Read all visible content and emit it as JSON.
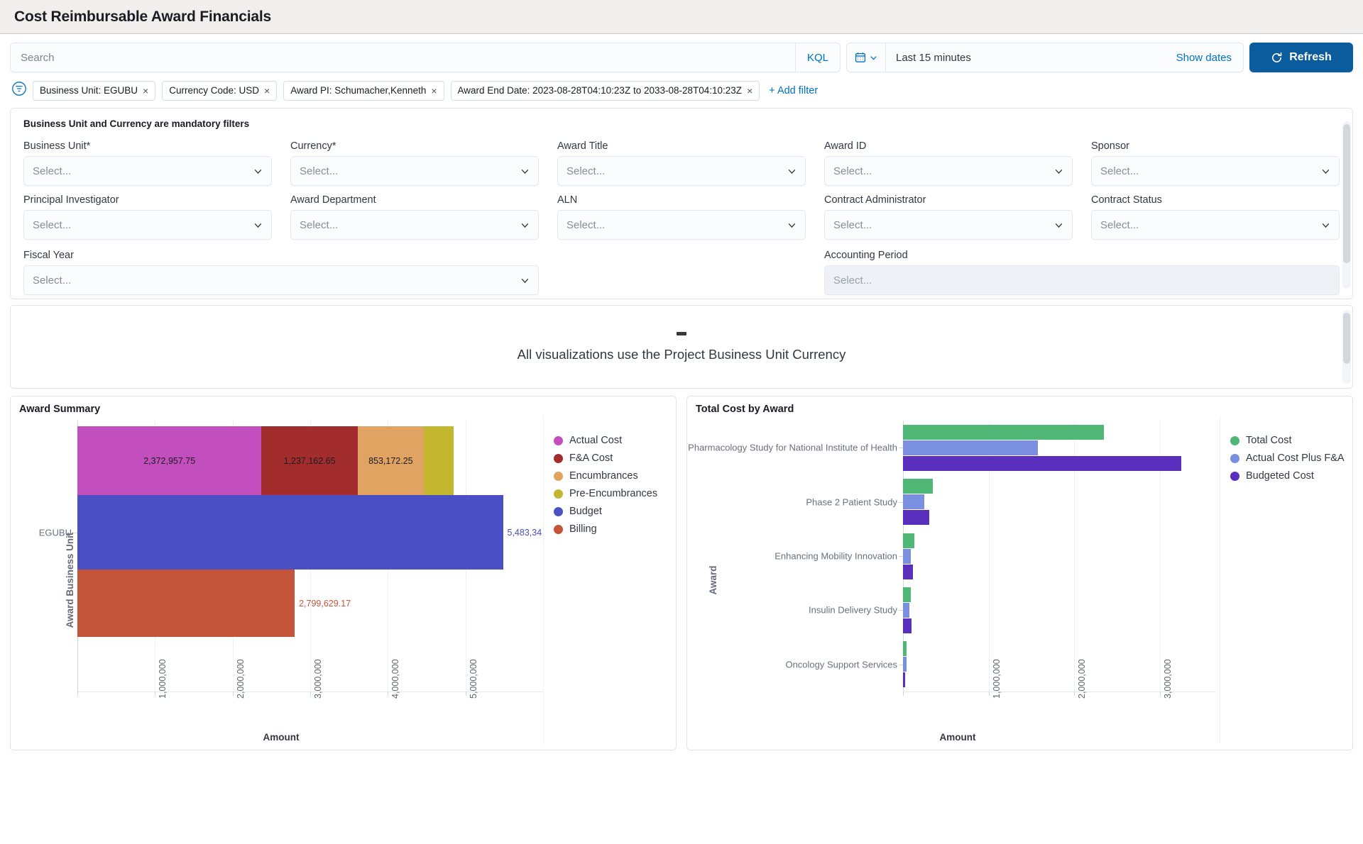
{
  "header": {
    "title": "Cost Reimbursable Award Financials"
  },
  "query": {
    "search_placeholder": "Search",
    "search_value": "",
    "kql_label": "KQL",
    "calendar_icon": "calendar-icon",
    "date_range": "Last 15 minutes",
    "show_dates_label": "Show dates",
    "refresh_label": "Refresh",
    "refresh_icon": "refresh-icon"
  },
  "filters": {
    "toggle_icon": "filter-toggle-icon",
    "pills": [
      {
        "label": "Business Unit: EGUBU"
      },
      {
        "label": "Currency Code: USD"
      },
      {
        "label": "Award PI: Schumacher,Kenneth"
      },
      {
        "label": "Award End Date: 2023-08-28T04:10:23Z to 2033-08-28T04:10:23Z"
      }
    ],
    "remove_glyph": "×",
    "add_filter_label": "+ Add filter"
  },
  "controls": {
    "note": "Business Unit and Currency are mandatory filters",
    "placeholder": "Select...",
    "fields": [
      {
        "label": "Business Unit*",
        "value": "Select...",
        "disabled": false
      },
      {
        "label": "Currency*",
        "value": "Select...",
        "disabled": false
      },
      {
        "label": "Award Title",
        "value": "Select...",
        "disabled": false
      },
      {
        "label": "Award ID",
        "value": "Select...",
        "disabled": false
      },
      {
        "label": "Sponsor",
        "value": "Select...",
        "disabled": false
      },
      {
        "label": "Principal Investigator",
        "value": "Select...",
        "disabled": false
      },
      {
        "label": "Award Department",
        "value": "Select...",
        "disabled": false
      },
      {
        "label": "ALN",
        "value": "Select...",
        "disabled": false
      },
      {
        "label": "Contract Administrator",
        "value": "Select...",
        "disabled": false
      },
      {
        "label": "Contract Status",
        "value": "Select...",
        "disabled": false
      }
    ],
    "row3": [
      {
        "label": "Fiscal Year",
        "value": "Select...",
        "disabled": false
      },
      {
        "label": "Accounting Period",
        "value": "Select...",
        "disabled": true
      }
    ]
  },
  "text_panel": {
    "message": "All visualizations use the Project Business Unit Currency"
  },
  "chart_data": [
    {
      "type": "bar",
      "orientation": "horizontal",
      "title": "Award Summary",
      "xlabel": "Amount",
      "ylabel": "Award Business Unit",
      "categories": [
        "EGUBU"
      ],
      "xlim": [
        0,
        6000000
      ],
      "xticks": [
        1000000,
        2000000,
        3000000,
        4000000,
        5000000
      ],
      "xtick_labels": [
        "1,000,000",
        "2,000,000",
        "3,000,000",
        "4,000,000",
        "5,000,000"
      ],
      "grid": true,
      "legend_position": "right",
      "stacked_row_1": true,
      "series": [
        {
          "name": "Actual Cost",
          "color": "#c24fbd",
          "value": 2372957.75,
          "label": "2,372,957.75"
        },
        {
          "name": "F&A Cost",
          "color": "#a32d2d",
          "value": 1237162.65,
          "label": "1,237,162.65"
        },
        {
          "name": "Encumbrances",
          "color": "#e0a361",
          "value": 853172.25,
          "label": "853,172.25"
        },
        {
          "name": "Pre-Encumbrances",
          "color": "#c3b72f",
          "value": 380000.0,
          "label": ""
        },
        {
          "name": "Budget",
          "color": "#4b4fc4",
          "value": 5483340.0,
          "label": "5,483,34"
        },
        {
          "name": "Billing",
          "color": "#c4543a",
          "value": 2799629.17,
          "label": "2,799,629.17"
        }
      ]
    },
    {
      "type": "bar",
      "orientation": "horizontal",
      "title": "Total Cost by Award",
      "xlabel": "Amount",
      "ylabel": "Award",
      "categories": [
        "Pharmacology Study for National Institute of Health",
        "Phase 2 Patient Study",
        "Enhancing Mobility Innovation",
        "Insulin Delivery Study",
        "Oncology Support Services"
      ],
      "xlim": [
        0,
        3650000
      ],
      "xticks": [
        1000000,
        2000000,
        3000000
      ],
      "xtick_labels": [
        "1,000,000",
        "2,000,000",
        "3,000,000"
      ],
      "grid": true,
      "legend_position": "right",
      "series": [
        {
          "name": "Total Cost",
          "color": "#4fb877",
          "values": [
            2350000,
            350000,
            130000,
            90000,
            45000
          ]
        },
        {
          "name": "Actual Cost Plus F&A",
          "color": "#7a8fe0",
          "values": [
            1580000,
            250000,
            90000,
            72000,
            38000
          ]
        },
        {
          "name": "Budgeted Cost",
          "color": "#5b2fbd",
          "values": [
            3250000,
            310000,
            120000,
            100000,
            28000
          ]
        }
      ]
    }
  ]
}
